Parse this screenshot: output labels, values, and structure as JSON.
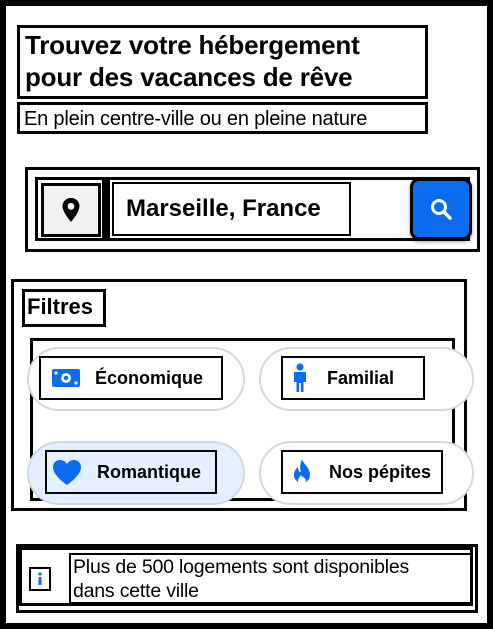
{
  "header": {
    "title_line1": "Trouvez votre hébergement",
    "title_line2": "pour des vacances de rêve",
    "subtitle": "En plein centre-ville ou en pleine nature"
  },
  "search": {
    "location_icon": "map-pin-icon",
    "location_value": "Marseille, France",
    "search_icon": "magnifier-icon",
    "accent_color": "#0a6cf0"
  },
  "filters": {
    "label": "Filtres",
    "items": [
      {
        "label": "Économique",
        "icon": "banknote-icon",
        "active": false
      },
      {
        "label": "Familial",
        "icon": "person-icon",
        "active": false
      },
      {
        "label": "Romantique",
        "icon": "heart-icon",
        "active": true
      },
      {
        "label": "Nos pépites",
        "icon": "flame-icon",
        "active": false
      }
    ],
    "active_bg_color": "#e4efff",
    "icon_color": "#0a6cf0"
  },
  "info": {
    "icon": "info-icon",
    "line1": "Plus de 500 logements sont disponibles",
    "line2": "dans cette ville"
  }
}
